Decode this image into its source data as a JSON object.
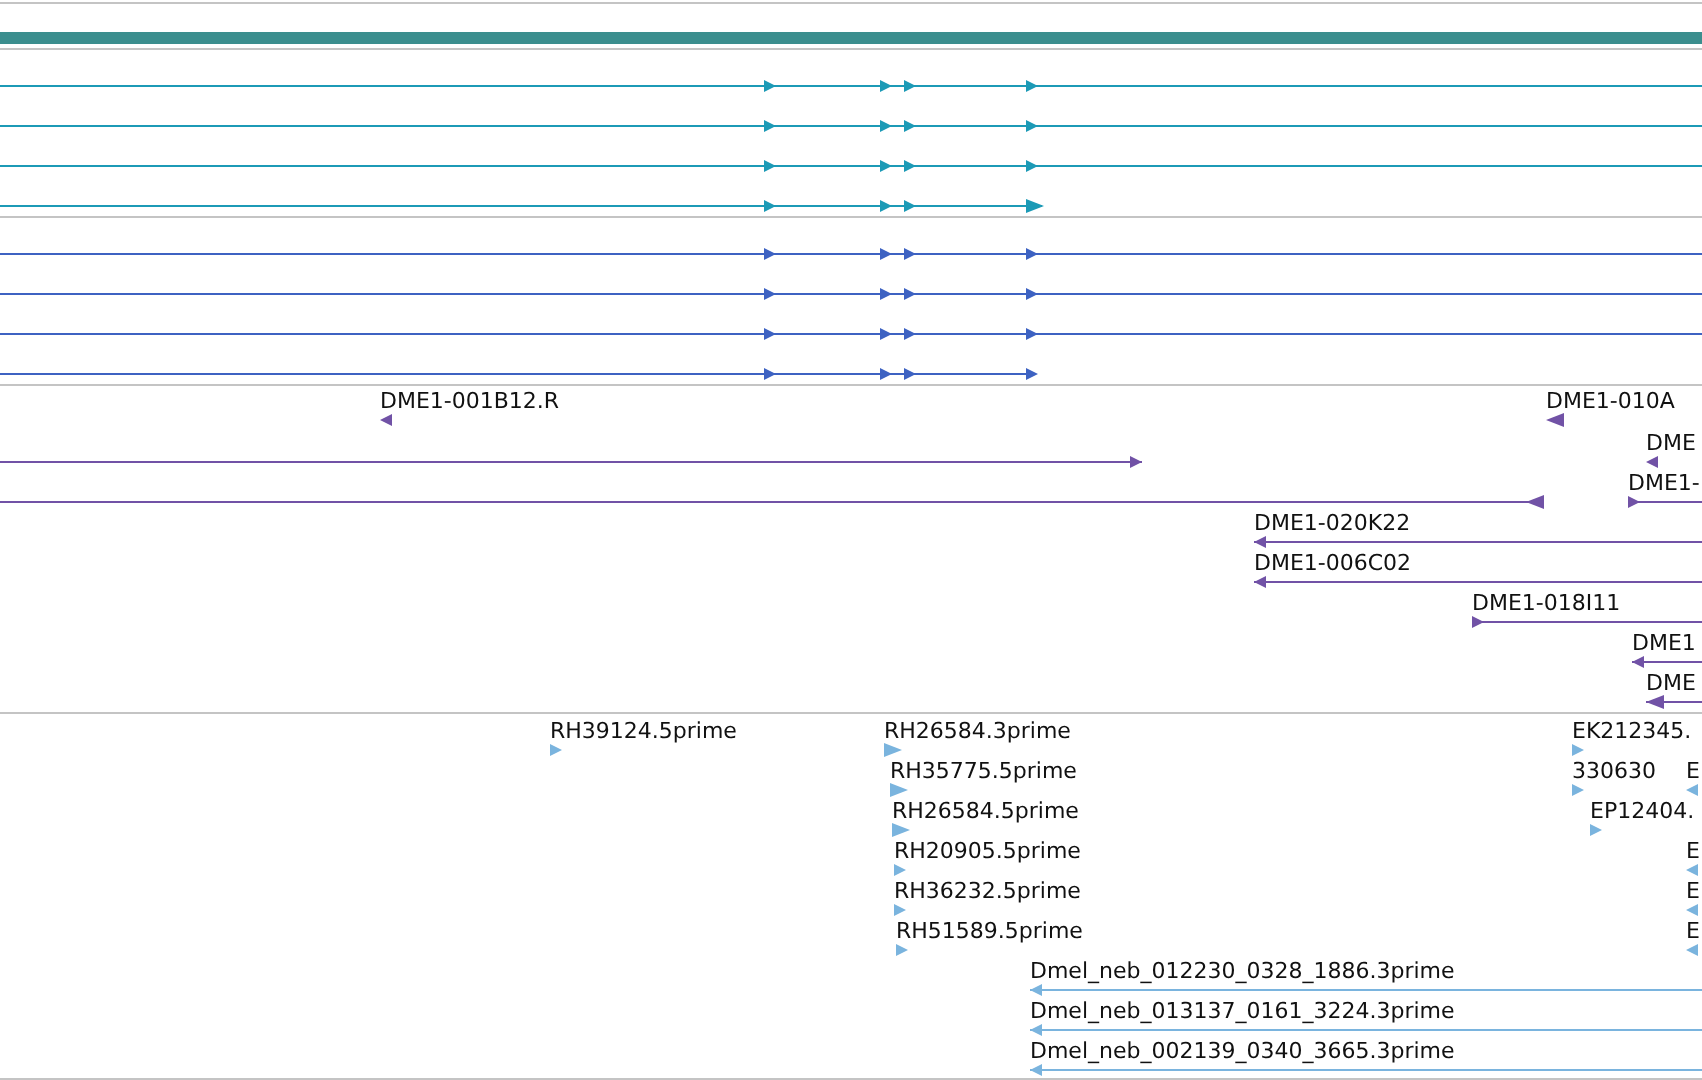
{
  "tracks": [
    {
      "kind": "bar",
      "color": "#3b8e8e"
    },
    {
      "kind": "transcripts",
      "color": "#1c9ab6",
      "features": [
        {
          "reverse": false
        },
        {
          "reverse": false
        },
        {
          "reverse": false
        },
        {
          "reverse": false
        }
      ]
    },
    {
      "kind": "transcripts",
      "color": "#3d62c2",
      "features": [
        {
          "reverse": false
        },
        {
          "reverse": false
        },
        {
          "reverse": false
        },
        {
          "reverse": false
        }
      ]
    },
    {
      "kind": "features",
      "color": "#7152a6",
      "features": [
        {
          "label": "DME1-001B12.R",
          "reverse": true
        },
        {
          "reverse": false
        },
        {
          "reverse": true
        },
        {
          "label": "DME1-010A",
          "reverse": true
        },
        {
          "label": "DME",
          "reverse": true
        },
        {
          "label": "DME1-",
          "reverse": false
        },
        {
          "label": "DME1-020K22",
          "reverse": true
        },
        {
          "label": "DME1-006C02",
          "reverse": true
        },
        {
          "label": "DME1-018I11",
          "reverse": false
        },
        {
          "label": "DME1",
          "reverse": true
        },
        {
          "label": "DME",
          "reverse": true
        }
      ]
    },
    {
      "kind": "features",
      "color": "#7ab4de",
      "features": [
        {
          "label": "RH39124.5prime",
          "reverse": false
        },
        {
          "label": "RH26584.3prime",
          "reverse": false
        },
        {
          "label": "EK212345.",
          "reverse": false
        },
        {
          "label": "RH35775.5prime",
          "reverse": false
        },
        {
          "label": "330630",
          "reverse": false
        },
        {
          "label": "E",
          "reverse": true
        },
        {
          "label": "RH26584.5prime",
          "reverse": false
        },
        {
          "label": "EP12404.",
          "reverse": false
        },
        {
          "label": "RH20905.5prime",
          "reverse": false
        },
        {
          "label": "E",
          "reverse": true
        },
        {
          "label": "RH36232.5prime",
          "reverse": false
        },
        {
          "label": "E",
          "reverse": true
        },
        {
          "label": "RH51589.5prime",
          "reverse": false
        },
        {
          "label": "E",
          "reverse": true
        },
        {
          "label": "Dmel_neb_012230_0328_1886.3prime",
          "reverse": true
        },
        {
          "label": "Dmel_neb_013137_0161_3224.3prime",
          "reverse": true
        },
        {
          "label": "Dmel_neb_002139_0340_3665.3prime",
          "reverse": true
        }
      ]
    }
  ]
}
